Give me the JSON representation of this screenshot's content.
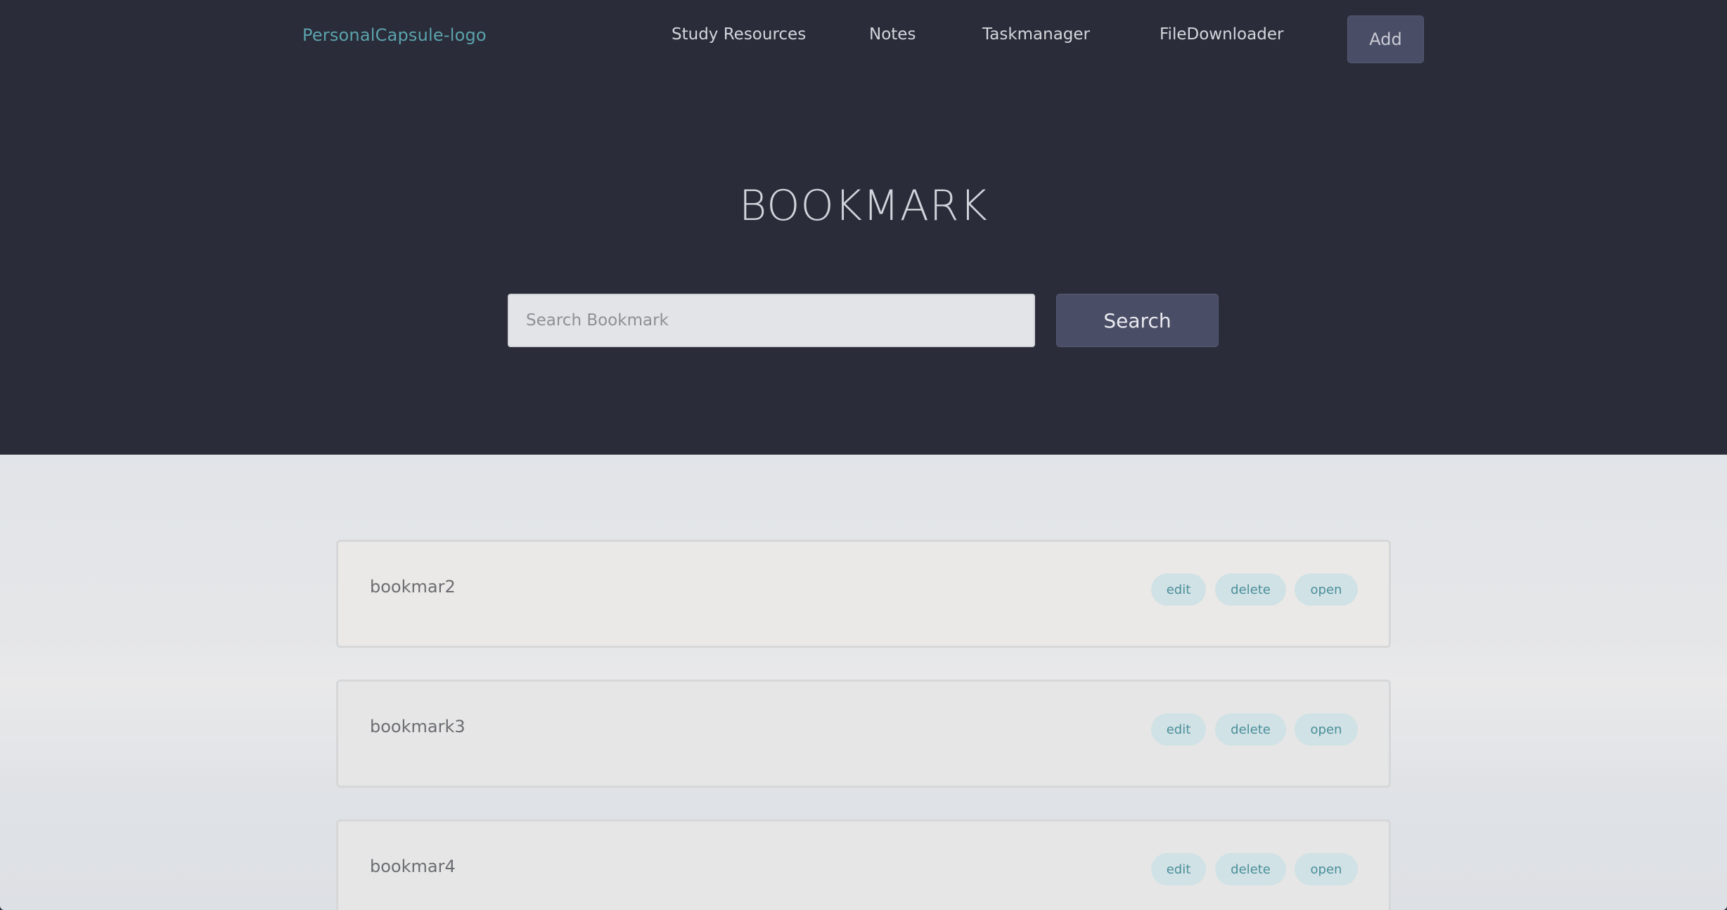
{
  "header": {
    "logo": "PersonalCapsule-logo",
    "nav": [
      "Study Resources",
      "Notes",
      "Taskmanager",
      "FileDownloader"
    ],
    "add_label": "Add"
  },
  "hero": {
    "title": "BOOKMARK",
    "search_placeholder": "Search Bookmark",
    "search_label": "Search"
  },
  "bookmarks": [
    {
      "title": "bookmar2",
      "edit": "edit",
      "delete": "delete",
      "open": "open"
    },
    {
      "title": "bookmark3",
      "edit": "edit",
      "delete": "delete",
      "open": "open"
    },
    {
      "title": "bookmar4",
      "edit": "edit",
      "delete": "delete",
      "open": "open"
    }
  ],
  "colors": {
    "hero_bg": "#2a2c39",
    "accent": "#5ba3ad",
    "button_bg": "#4a4d66",
    "pill_bg": "#d0e2e5"
  }
}
